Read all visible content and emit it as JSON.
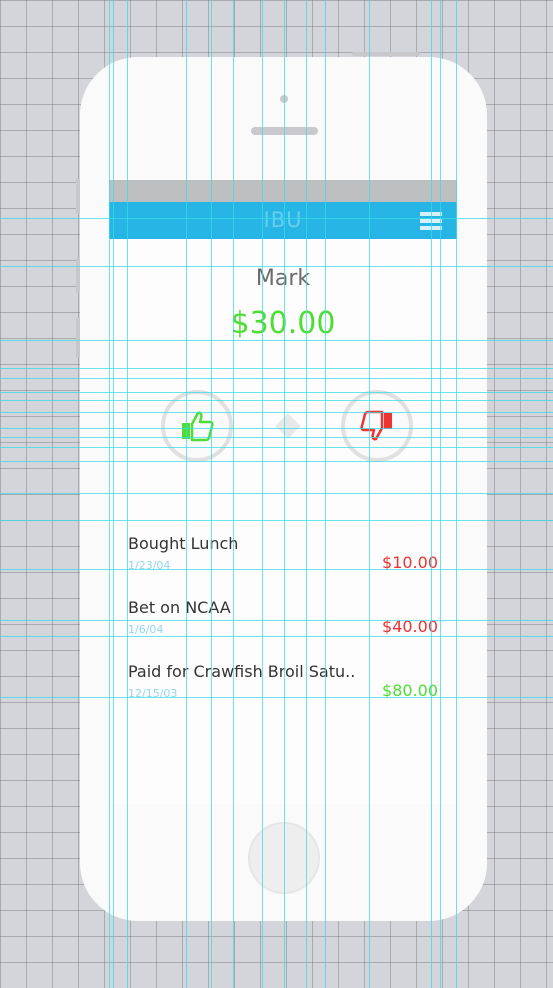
{
  "app": {
    "title": "IBU"
  },
  "account": {
    "name": "Mark",
    "balance": "$30.00"
  },
  "actions": {
    "approve_icon": "thumbs-up-icon",
    "reject_icon": "thumbs-down-icon"
  },
  "transactions": [
    {
      "description": "Bought Lunch",
      "date": "1/23/04",
      "amount": "$10.00",
      "color": "#ee3333"
    },
    {
      "description": "Bet on NCAA",
      "date": "1/6/04",
      "amount": "$40.00",
      "color": "#ee3333"
    },
    {
      "description": "Paid for Crawfish Broil Satu..",
      "date": "12/15/03",
      "amount": "$80.00",
      "color": "#4ddd33"
    }
  ],
  "colors": {
    "nav": "#27b5e5",
    "positive": "#4ddd33",
    "negative": "#ee3333"
  }
}
